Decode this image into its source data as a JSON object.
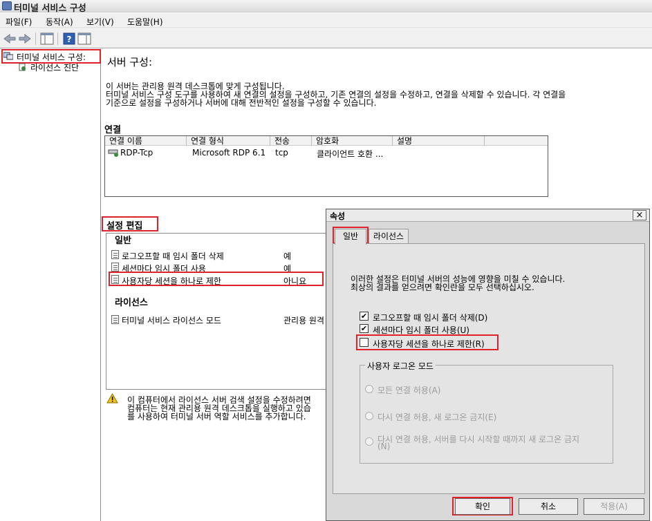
{
  "window": {
    "title": "터미널 서비스 구성"
  },
  "menu": [
    "파일(F)",
    "동작(A)",
    "보기(V)",
    "도움말(H)"
  ],
  "tree": {
    "root": "터미널 서비스 구성:",
    "child": "라이선스 진단"
  },
  "main": {
    "title": "서버 구성:",
    "intro1": "이 서버는 관리용 원격 데스크톱에 맞게 구성됩니다.",
    "intro2": "터미널 서비스 구성 도구를 사용하여 새 연결의 설정을 구성하고, 기존 연결의 설정을 수정하고, 연결을 삭제할 수 있습니다. 각 연결을",
    "intro3": "기준으로 설정을 구성하거나 서버에 대해 전반적인 설정을 구성할 수 있습니다.",
    "connections_title": "연결",
    "columns": [
      "연결 이름",
      "연결 형식",
      "전송",
      "암호화",
      "설명"
    ],
    "row": {
      "name": "RDP-Tcp",
      "type": "Microsoft RDP 6.1",
      "transport": "tcp",
      "encryption": "클라이언트 호환 ...",
      "desc": ""
    },
    "edit_title": "설정 편집",
    "general_header": "일반",
    "settings": [
      {
        "label": "로그오프할 때 임시 폴더 삭제",
        "value": "예"
      },
      {
        "label": "세션마다 임시 폴더 사용",
        "value": "예"
      },
      {
        "label": "사용자당 세션을 하나로 제한",
        "value": "아니요"
      }
    ],
    "license_header": "라이선스",
    "license_setting": {
      "label": "터미널 서비스 라이선스 모드",
      "value": "관리용 원격"
    },
    "warning1": "이 컴퓨터에서 라이선스 서버 검색 설정을 수정하려면",
    "warning2": "컴퓨터는 현재 관리용 원격 데스크톱을 실행하고 있습",
    "warning3": "를 사용하여 터미널 서버 역할 서비스를 추가합니다."
  },
  "dialog": {
    "title": "속성",
    "close": "×",
    "tabs": [
      "일반",
      "라이선스"
    ],
    "note1": "이러한 설정은 터미널 서버의 성능에 영향을 미칠 수 있습니다.",
    "note2": "최상의 결과를 얻으려면 확인란을 모두 선택하십시오.",
    "checkboxes": [
      {
        "label": "로그오프할 때 임시 폴더 삭제(D)",
        "checked": true
      },
      {
        "label": "세션마다 임시 폴더 사용(U)",
        "checked": true
      },
      {
        "label": "사용자당 세션을 하나로 제한(R)",
        "checked": false
      }
    ],
    "group_title": "사용자 로그온 모드",
    "radios": [
      "모든 연결 허용(A)",
      "다시 연결 허용, 새 로그온 금지(E)",
      "다시 연결 허용, 서버를 다시 시작할 때까지 새 로그온 금지",
      "(N)"
    ],
    "buttons": {
      "ok": "확인",
      "cancel": "취소",
      "apply": "적용(A)"
    }
  },
  "colors": {
    "highlight": "#e2202a",
    "dialog_bg": "#d9d9d9"
  }
}
